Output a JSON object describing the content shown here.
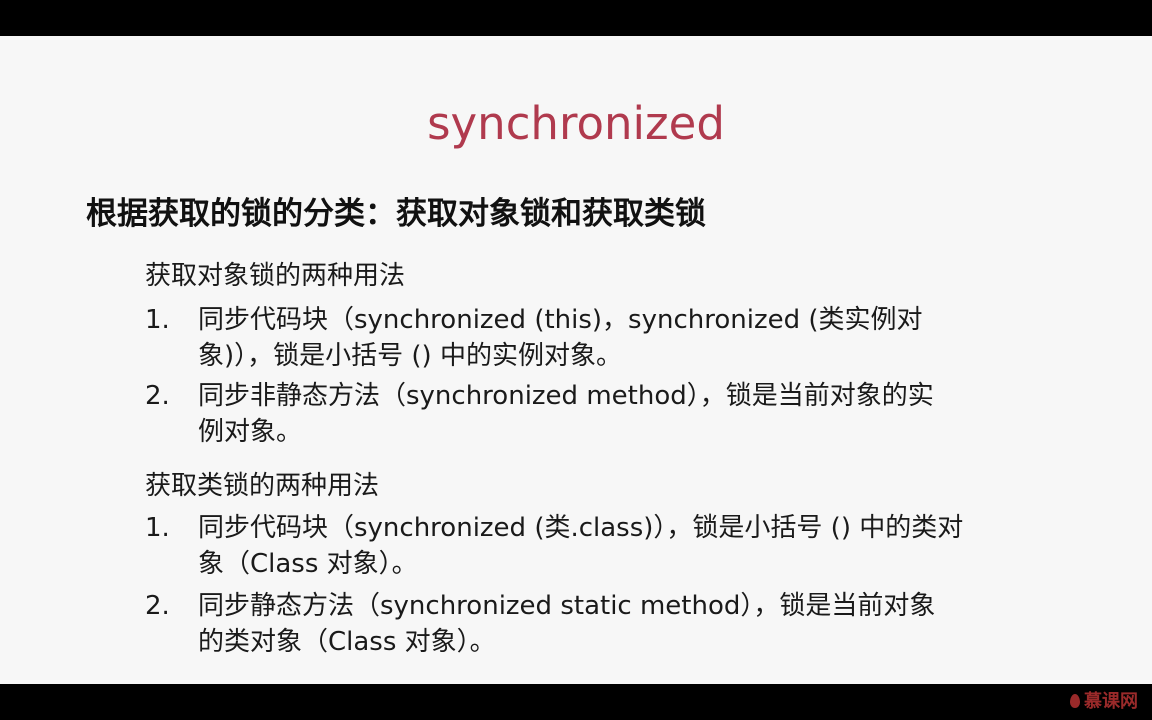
{
  "slide": {
    "title": "synchronized",
    "subtitle": "根据获取的锁的分类：获取对象锁和获取类锁",
    "sections": [
      {
        "heading": "获取对象锁的两种用法",
        "items": [
          {
            "number": "1.",
            "text": "同步代码块（synchronized (this)，synchronized (类实例对\n象)），锁是小括号 () 中的实例对象。"
          },
          {
            "number": "2.",
            "text": "同步非静态方法（synchronized method），锁是当前对象的实\n例对象。"
          }
        ]
      },
      {
        "heading": "获取类锁的两种用法",
        "items": [
          {
            "number": "1.",
            "text": "同步代码块（synchronized (类.class)），锁是小括号 () 中的类对\n象（Class 对象）。"
          },
          {
            "number": "2.",
            "text": "同步静态方法（synchronized static method），锁是当前对象\n的类对象（Class 对象）。"
          }
        ]
      }
    ]
  },
  "watermark": {
    "text": "慕课网",
    "icon": "flame-icon"
  },
  "colors": {
    "title": "#b03a4e",
    "background": "#f7f7f7",
    "letterbox": "#000000"
  }
}
